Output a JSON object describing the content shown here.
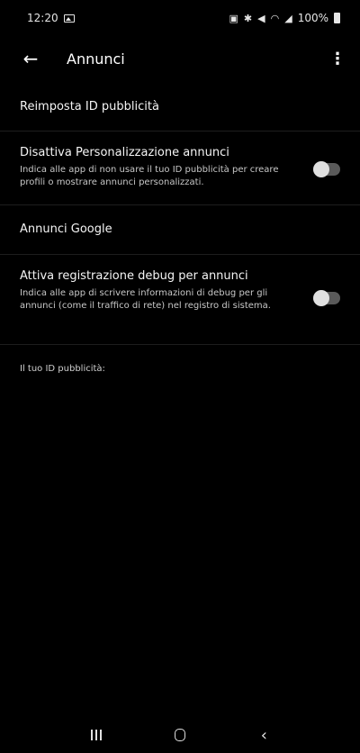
{
  "status_bar": {
    "time": "12:20",
    "icons": [
      "gallery-icon",
      "nfc-icon",
      "bluetooth-icon",
      "mute-icon",
      "wifi-icon",
      "signal-icon",
      "battery-icon"
    ],
    "battery": "100%"
  },
  "app_bar": {
    "title": "Annunci",
    "back_icon": "arrow-left-icon",
    "more_icon": "more-vert-icon"
  },
  "settings": {
    "reset_id": {
      "title": "Reimposta ID pubblicità"
    },
    "disable_personalization": {
      "title": "Disattiva Personalizzazione annunci",
      "summary": "Indica alle app di non usare il tuo ID pubblicità per creare profili o mostrare annunci personalizzati.",
      "enabled": false
    },
    "google_ads": {
      "title": "Annunci Google"
    },
    "debug_logging": {
      "title": "Attiva registrazione debug per annunci",
      "summary": "Indica alle app di scrivere informazioni di debug per gli annunci (come il traffico di rete) nel registro di sistema.",
      "enabled": false
    },
    "ad_id_label": "Il tuo ID pubblicità:"
  },
  "nav_bar": {
    "recents": "recents-icon",
    "home": "home-icon",
    "back": "back-icon"
  }
}
